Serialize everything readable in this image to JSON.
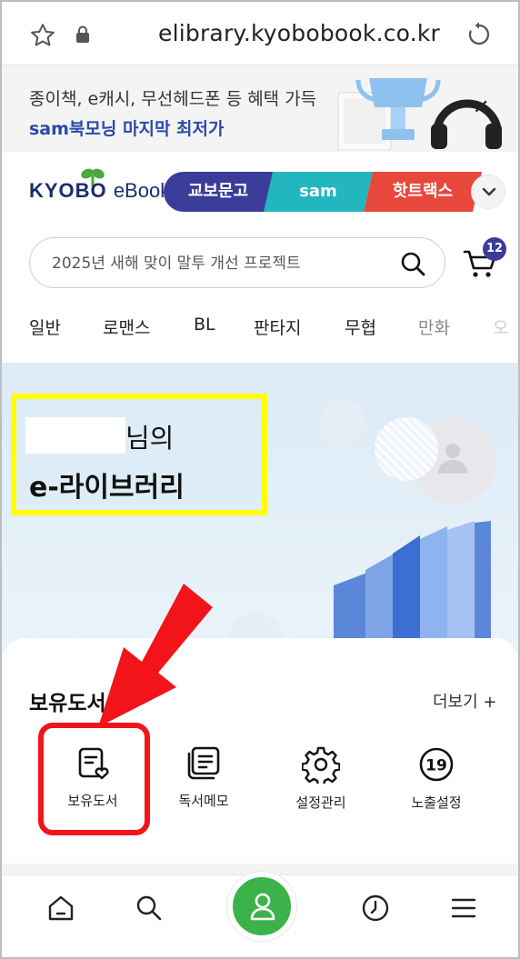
{
  "browser": {
    "url": "elibrary.kyobobook.co.kr"
  },
  "promo": {
    "line1": "종이책, e캐시, 무선헤드폰 등 혜택 가득",
    "line2": "sam북모닝 마지막 최저가",
    "close": "✕"
  },
  "header": {
    "logo_main": "KYOBO",
    "logo_sub": "eBook",
    "strip_tabs": [
      "교보문고",
      "sam",
      "핫트랙스"
    ],
    "colors": {
      "kyobo": "#3b3c9a",
      "sam": "#22b6bf",
      "hot": "#e8473c"
    }
  },
  "search": {
    "placeholder": "2025년 새해 맞이 말투 개선 프로젝트",
    "cart_count": "12"
  },
  "categories": [
    "일반",
    "로맨스",
    "BL",
    "판타지",
    "무협",
    "만화",
    "오"
  ],
  "hero": {
    "suffix": "님의",
    "title": "e-라이브러리"
  },
  "owned": {
    "title": "보유도서",
    "more": "더보기 +",
    "actions": [
      {
        "label": "보유도서",
        "icon": "owned-books-icon"
      },
      {
        "label": "독서메모",
        "icon": "reading-memo-icon"
      },
      {
        "label": "설정관리",
        "icon": "settings-gear-icon"
      },
      {
        "label": "노출설정",
        "icon": "age-19-icon"
      }
    ]
  },
  "nav": {
    "items": [
      "home-icon",
      "search-icon",
      "user-icon",
      "clock-icon",
      "menu-icon"
    ],
    "accent": "#3cb24a"
  },
  "annotation": {
    "highlight": "#ffff00",
    "marker": "#f2141a"
  }
}
